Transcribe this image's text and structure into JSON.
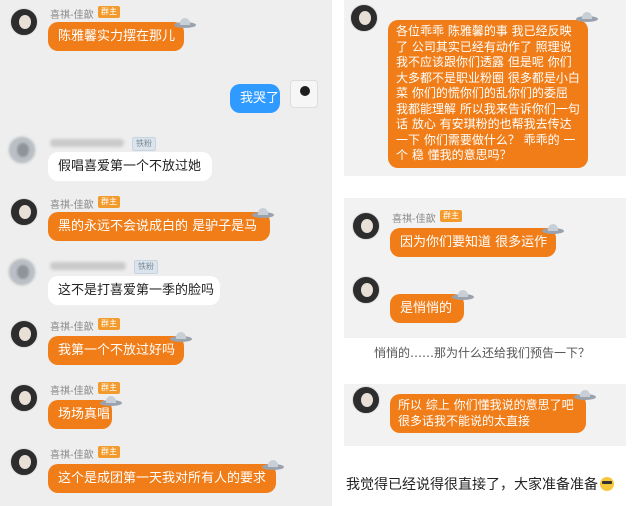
{
  "left": {
    "messages": [
      {
        "sender": "喜祺-佳歆",
        "badge": "群主",
        "text": "陈雅馨实力摆在那儿"
      },
      {
        "sender": "me",
        "text": "我哭了"
      },
      {
        "sender": "",
        "badge": "铁粉",
        "text": "假唱喜爱第一个不放过她"
      },
      {
        "sender": "喜祺-佳歆",
        "badge": "群主",
        "text": "黑的永远不会说成白的 是驴子是马"
      },
      {
        "sender": "",
        "badge": "铁粉",
        "text": "这不是打喜爱第一季的脸吗"
      },
      {
        "sender": "喜祺-佳歆",
        "badge": "群主",
        "text": "我第一个不放过好吗"
      },
      {
        "sender": "喜祺-佳歆",
        "badge": "群主",
        "text": "场场真唱"
      },
      {
        "sender": "喜祺-佳歆",
        "badge": "群主",
        "text": "这个是成团第一天我对所有人的要求"
      }
    ]
  },
  "right": {
    "top_message": "各位乖乖 陈雅馨的事 我已经反映了 公司其实已经有动作了 照理说 我不应该跟你们透露 但是呢 你们大多都不是职业粉圈 很多都是小白菜 你们的慌你们的乱你们的委屈 我都能理解 所以我来告诉你们一句话 放心 有安琪粉的也帮我去传达一下 你们需要做什么？ 乖乖的 一个 稳 懂我的意思吗？",
    "mid": [
      {
        "sender": "喜祺-佳歆",
        "badge": "群主",
        "text": "因为你们要知道 很多运作"
      },
      {
        "sender": "",
        "text": "是悄悄的"
      }
    ],
    "caption": "悄悄的……那为什么还给我们预告一下？",
    "bottom_message": "所以 综上 你们懂我说的意思了吧 很多话我不能说的太直接",
    "footer": "我觉得已经说得很直接了，大家准备准备"
  }
}
